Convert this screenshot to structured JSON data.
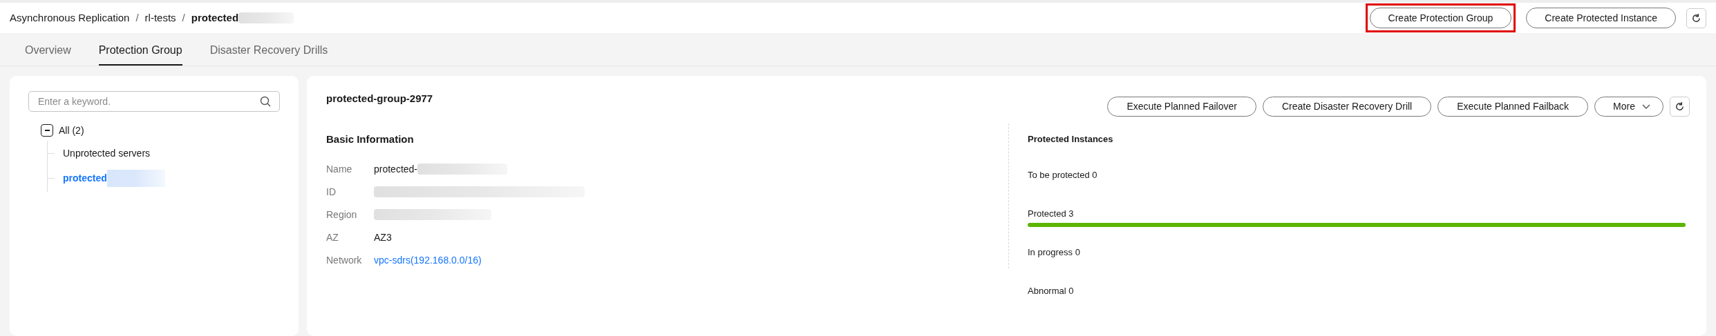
{
  "breadcrumb_separator": "/",
  "breadcrumb": [
    {
      "label": "Asynchronous Replication",
      "current": false,
      "blurred": false
    },
    {
      "label": "rl-tests",
      "current": false,
      "blurred": false
    },
    {
      "label": "protected",
      "current": true,
      "blurred": true
    }
  ],
  "header_buttons": [
    {
      "label": "Create Protection Group",
      "highlighted": true
    },
    {
      "label": "Create Protected Instance",
      "highlighted": false
    }
  ],
  "tabs": [
    {
      "label": "Overview",
      "selected": false
    },
    {
      "label": "Protection Group",
      "selected": true
    },
    {
      "label": "Disaster Recovery Drills",
      "selected": false
    }
  ],
  "sidebar": {
    "search": {
      "placeholder": "Enter a keyword."
    },
    "tree": [
      {
        "label": "All (2)",
        "expanded": true,
        "selected": false,
        "children": [
          {
            "label": "Unprotected servers",
            "selected": false,
            "blurred": false
          },
          {
            "label": "protected",
            "selected": true,
            "blurred": true
          }
        ]
      }
    ]
  },
  "group": {
    "title": "protected-group-2977",
    "actions": [
      "Execute Planned Failover",
      "Create Disaster Recovery Drill",
      "Execute Planned Failback"
    ],
    "more": "More",
    "basic_information": {
      "title": "Basic Information",
      "fields": [
        {
          "label": "Name",
          "value": "protected-",
          "kind": "text",
          "blurred": true
        },
        {
          "label": "ID",
          "blurred": true
        },
        {
          "label": "Region",
          "blurred": true
        },
        {
          "label": "AZ",
          "value": "AZ3",
          "kind": "text",
          "blurred": false
        },
        {
          "label": "Network",
          "value": "vpc-sdrs(192.168.0.0/16)",
          "kind": "link",
          "blurred": false
        }
      ]
    },
    "protected_instances": {
      "title": "Protected Instances",
      "stats": [
        {
          "label": "To be protected 0"
        },
        {
          "label": "Protected 3",
          "level": 1
        },
        {
          "label": "In progress 0"
        },
        {
          "label": "Abnormal 0"
        }
      ]
    }
  }
}
